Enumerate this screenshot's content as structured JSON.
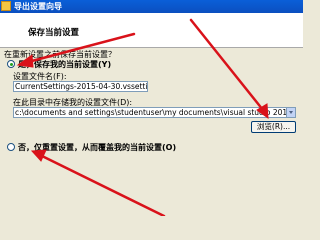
{
  "window": {
    "title": "导出设置向导"
  },
  "header": {
    "title": "保存当前设置"
  },
  "description": "在重新设置之前保存当前设置？",
  "option_save": {
    "label": "是，保存我的当前设置(Y)",
    "checked": true,
    "filename_label": "设置文件名(F):",
    "filename_value": "CurrentSettings-2015-04-30.vssettings",
    "dir_label": "在此目录中存储我的设置文件(D):",
    "dir_value": "c:\\documents and settings\\studentuser\\my documents\\visual studio 2010\\Settings",
    "browse_label": "浏览(R)..."
  },
  "option_overwrite": {
    "label": "否，仅重置设置，从而覆盖我的当前设置(O)",
    "checked": false
  },
  "colors": {
    "annotation_arrow": "#d9121a",
    "titlebar": "#0b55cf"
  },
  "icons": {
    "title": "wizard-icon",
    "arrows": "red-annotation-arrow"
  }
}
